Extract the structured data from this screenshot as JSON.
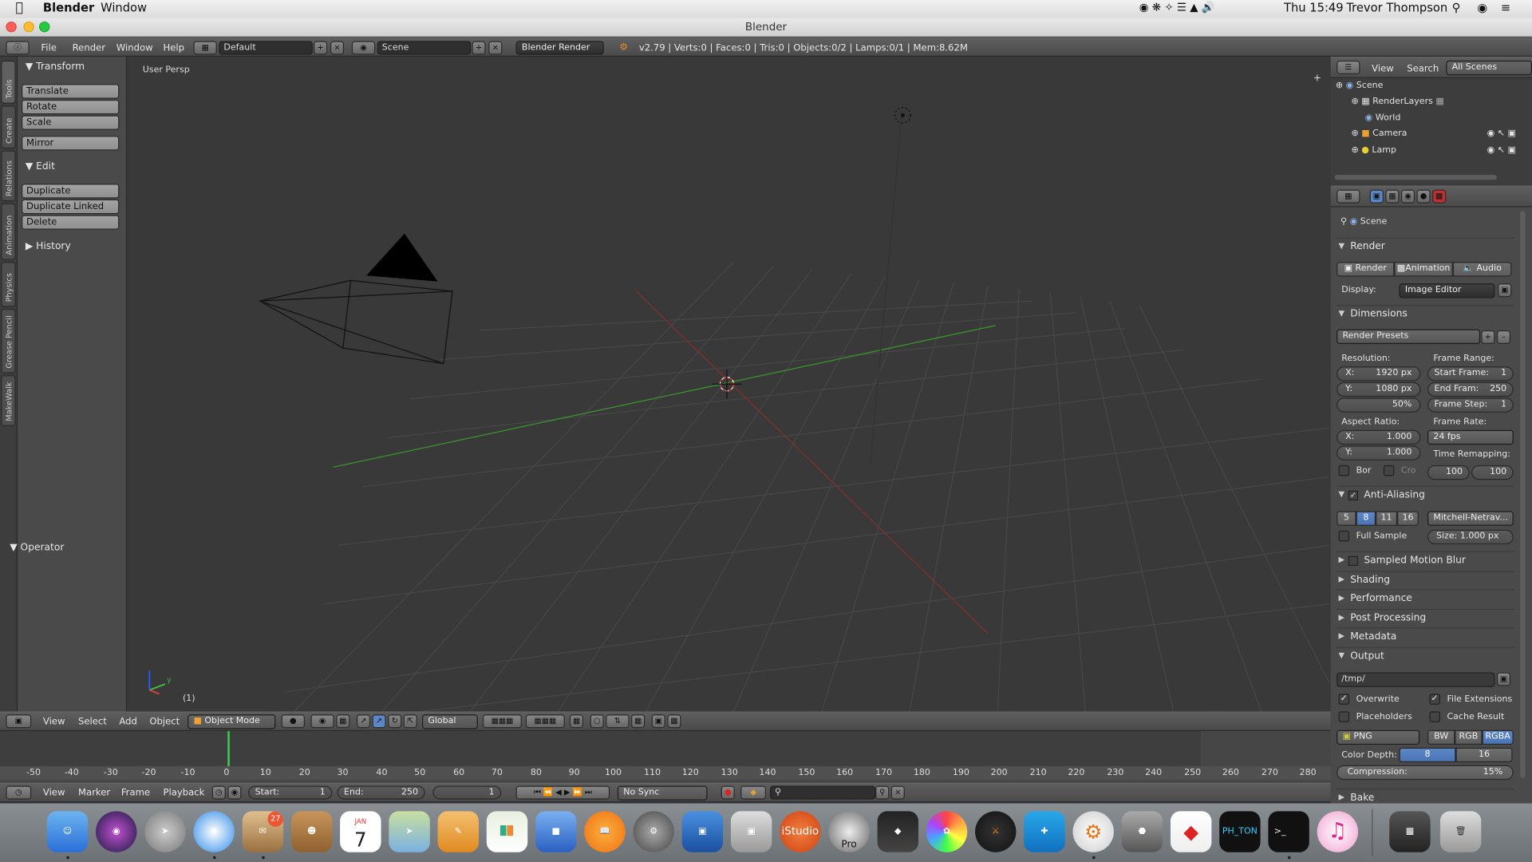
{
  "menubar": {
    "app": "Blender",
    "window": "Window",
    "clock": "Thu 15:49",
    "user": "Trevor Thompson"
  },
  "titlebar": {
    "title": "Blender"
  },
  "topbar": {
    "menus": [
      "File",
      "Render",
      "Window",
      "Help"
    ],
    "layout": "Default",
    "scene": "Scene",
    "engine": "Blender Render",
    "stats": "v2.79 | Verts:0 | Faces:0 | Tris:0 | Objects:0/2 | Lamps:0/1 | Mem:8.62M"
  },
  "tool_tabs": [
    "Tools",
    "Create",
    "Relations",
    "Animation",
    "Physics",
    "Grease Pencil",
    "MakeWalk"
  ],
  "toolshelf": {
    "transform": "Transform",
    "transform_buttons": [
      "Translate",
      "Rotate",
      "Scale",
      "Mirror"
    ],
    "edit": "Edit",
    "edit_buttons": [
      "Duplicate",
      "Duplicate Linked",
      "Delete"
    ],
    "history": "History",
    "operator": "Operator"
  },
  "viewport": {
    "view_label": "User Persp",
    "frame_label": "(1)",
    "axis_x": "x",
    "axis_y": "y",
    "axis_z": "z"
  },
  "viewport_header": {
    "menus": [
      "View",
      "Select",
      "Add",
      "Object"
    ],
    "mode": "Object Mode",
    "orientation": "Global"
  },
  "outliner": {
    "view": "View",
    "search": "Search",
    "filter": "All Scenes",
    "items": [
      "Scene",
      "RenderLayers",
      "World",
      "Camera",
      "Lamp"
    ]
  },
  "props": {
    "context": "Scene",
    "render": "Render",
    "render_btn": "Render",
    "animation_btn": "Animation",
    "audio_btn": "Audio",
    "display_label": "Display:",
    "display_value": "Image Editor",
    "dimensions": "Dimensions",
    "presets": "Render Presets",
    "resolution": "Resolution:",
    "res_x": "X:",
    "res_x_val": "1920 px",
    "res_y": "Y:",
    "res_y_val": "1080 px",
    "res_pct": "50%",
    "frame_range": "Frame Range:",
    "start_frame": "Start Frame:",
    "start_frame_val": "1",
    "end_frame": "End Fram:",
    "end_frame_val": "250",
    "frame_step": "Frame Step:",
    "frame_step_val": "1",
    "aspect": "Aspect Ratio:",
    "asp_x": "X:",
    "asp_x_val": "1.000",
    "asp_y": "Y:",
    "asp_y_val": "1.000",
    "frame_rate": "Frame Rate:",
    "fps": "24 fps",
    "time_remap": "Time Remapping:",
    "remap_old": "100",
    "remap_new": "100",
    "bor": "Bor",
    "cro": "Cro",
    "anti_aliasing": "Anti-Aliasing",
    "aa_samples": [
      "5",
      "8",
      "11",
      "16"
    ],
    "aa_filter": "Mitchell-Netrav...",
    "full_sample": "Full Sample",
    "aa_size": "Size: 1.000 px",
    "motion_blur": "Sampled Motion Blur",
    "shading": "Shading",
    "performance": "Performance",
    "post_processing": "Post Processing",
    "metadata": "Metadata",
    "output": "Output",
    "output_path": "/tmp/",
    "overwrite": "Overwrite",
    "file_ext": "File Extensions",
    "placeholders": "Placeholders",
    "cache_result": "Cache Result",
    "format": "PNG",
    "color_modes": [
      "BW",
      "RGB",
      "RGBA"
    ],
    "color_depth": "Color Depth:",
    "depths": [
      "8",
      "16"
    ],
    "compression": "Compression:",
    "compression_val": "15%",
    "bake": "Bake"
  },
  "timeline": {
    "ticks": [
      "-50",
      "-40",
      "-30",
      "-20",
      "-10",
      "0",
      "10",
      "20",
      "30",
      "40",
      "50",
      "60",
      "70",
      "80",
      "90",
      "100",
      "110",
      "120",
      "130",
      "140",
      "150",
      "160",
      "170",
      "180",
      "190",
      "200",
      "210",
      "220",
      "230",
      "240",
      "250",
      "260",
      "270",
      "280"
    ],
    "menus": [
      "View",
      "Marker",
      "Frame",
      "Playback"
    ],
    "start": "Start:",
    "start_val": "1",
    "end": "End:",
    "end_val": "250",
    "current": "1",
    "sync": "No Sync"
  },
  "dock": {
    "apps": [
      "Finder",
      "Siri",
      "Launchpad",
      "Safari",
      "Mail",
      "Contacts",
      "Calendar",
      "Maps",
      "Pages",
      "Numbers",
      "Keynote",
      "iBooks",
      "System Preferences",
      "Remote Desktop",
      "Preview",
      "iStudio",
      "Aperture Pro",
      "Final Cut",
      "Photos",
      "Poser",
      "Tweetbot",
      "Blender",
      "Sketch",
      "SketchUp",
      "Photon",
      "Terminal",
      "iTunes",
      "Trash"
    ],
    "mail_badge": "27",
    "cal_month": "JAN",
    "cal_day": "7",
    "istudio": "iStudio",
    "pro": "Pro",
    "photon": "PH_TON"
  }
}
